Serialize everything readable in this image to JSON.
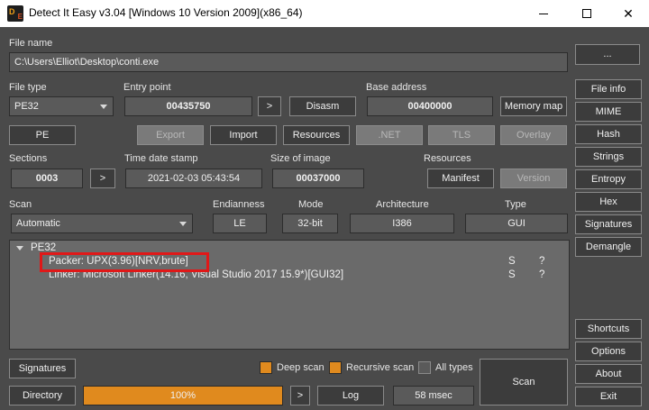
{
  "window": {
    "title": "Detect It Easy v3.04 [Windows 10 Version 2009](x86_64)",
    "logo_primary": "D",
    "logo_secondary": "E"
  },
  "file_name": {
    "label": "File name",
    "value": "C:\\Users\\Elliot\\Desktop\\conti.exe",
    "browse_label": "..."
  },
  "file_type": {
    "label": "File type",
    "value": "PE32"
  },
  "entry_point": {
    "label": "Entry point",
    "value": "00435750",
    "go_label": ">",
    "disasm_label": "Disasm"
  },
  "base_address": {
    "label": "Base address",
    "value": "00400000",
    "memory_map_label": "Memory map"
  },
  "row_buttons": {
    "pe": "PE",
    "export": "Export",
    "import": "Import",
    "resources": "Resources",
    "net": ".NET",
    "tls": "TLS",
    "overlay": "Overlay"
  },
  "sections": {
    "label": "Sections",
    "value": "0003",
    "go_label": ">"
  },
  "time_date_stamp": {
    "label": "Time date stamp",
    "value": "2021-02-03 05:43:54"
  },
  "size_of_image": {
    "label": "Size of image",
    "value": "00037000"
  },
  "resources_group": {
    "label": "Resources",
    "manifest_label": "Manifest",
    "version_label": "Version"
  },
  "scan": {
    "label": "Scan",
    "value": "Automatic"
  },
  "endianness": {
    "label": "Endianness",
    "value": "LE"
  },
  "mode": {
    "label": "Mode",
    "value": "32-bit"
  },
  "architecture": {
    "label": "Architecture",
    "value": "I386"
  },
  "type": {
    "label": "Type",
    "value": "GUI"
  },
  "tree": {
    "root": "PE32",
    "rows": [
      {
        "text": "Packer: UPX(3.96)[NRV,brute]",
        "flag_s": "S",
        "flag_q": "?"
      },
      {
        "text": "Linker: Microsoft Linker(14.16, Visual Studio 2017 15.9*)[GUI32]",
        "flag_s": "S",
        "flag_q": "?"
      }
    ]
  },
  "side_buttons": {
    "file_info": "File info",
    "mime": "MIME",
    "hash": "Hash",
    "strings": "Strings",
    "entropy": "Entropy",
    "hex": "Hex",
    "signatures": "Signatures",
    "demangle": "Demangle",
    "shortcuts": "Shortcuts",
    "options": "Options",
    "about": "About",
    "exit": "Exit"
  },
  "bottom": {
    "signatures_label": "Signatures",
    "directory_label": "Directory",
    "progress_text": "100%",
    "progress_fraction": 1.0,
    "go_label": ">",
    "log_label": "Log",
    "time_text": "58 msec",
    "scan_label": "Scan",
    "deep_scan_label": "Deep scan",
    "recursive_scan_label": "Recursive scan",
    "all_types_label": "All types"
  },
  "colors": {
    "accent": "#e08a1e",
    "highlight_box": "#e01818",
    "background": "#4a4a4a"
  }
}
